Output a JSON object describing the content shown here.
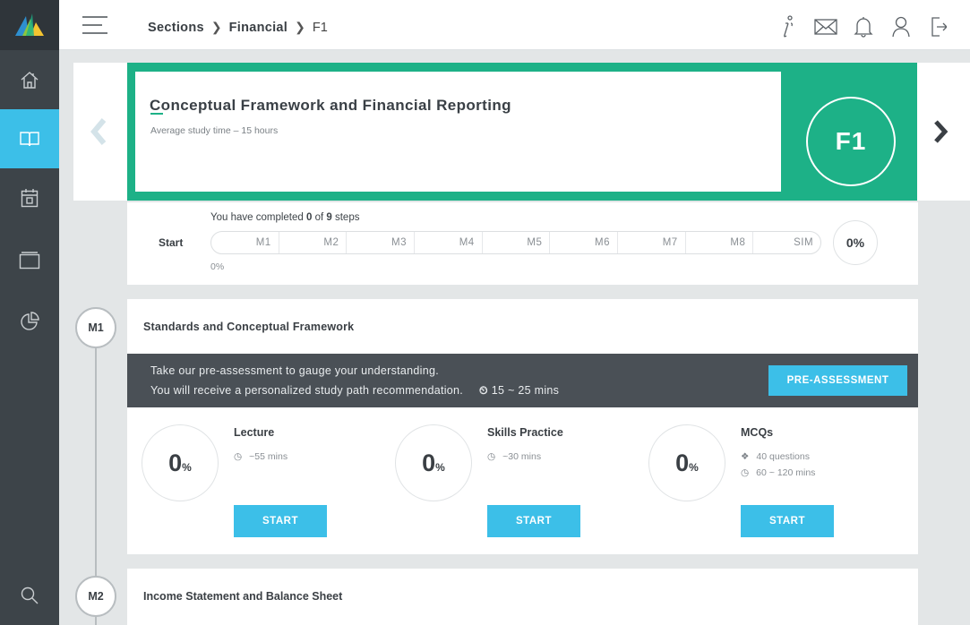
{
  "header": {
    "breadcrumb": [
      "Sections",
      "Financial",
      "F1"
    ]
  },
  "hero": {
    "title": "Conceptual Framework and Financial Reporting",
    "subtitle": "Average study time – 15 hours",
    "badge": "F1"
  },
  "progress": {
    "text_prefix": "You have completed ",
    "completed": "0",
    "text_middle": " of ",
    "total": "9",
    "text_suffix": " steps",
    "start_label": "Start",
    "steps": [
      "M1",
      "M2",
      "M3",
      "M4",
      "M5",
      "M6",
      "M7",
      "M8",
      "SIM"
    ],
    "percent": "0%",
    "below_percent": "0%"
  },
  "modules": [
    {
      "node": "M1",
      "title": "Standards and Conceptual Framework",
      "pre_assessment": {
        "line1": "Take our pre-assessment to gauge your understanding.",
        "line2": "You will receive a personalized study path recommendation.",
        "time": "15 ~ 25 mins",
        "button": "PRE-ASSESSMENT"
      },
      "activities": [
        {
          "title": "Lecture",
          "percent": "0",
          "meta1": "~55 mins",
          "meta2": "",
          "button": "START"
        },
        {
          "title": "Skills Practice",
          "percent": "0",
          "meta1": "~30 mins",
          "meta2": "",
          "button": "START"
        },
        {
          "title": "MCQs",
          "percent": "0",
          "meta1": "40 questions",
          "meta2": "60 ~ 120 mins",
          "button": "START"
        }
      ]
    },
    {
      "node": "M2",
      "title": "Income Statement and Balance Sheet"
    }
  ],
  "percent_symbol": "%",
  "colors": {
    "sidebar": "#3d4449",
    "accent_blue": "#3cbfe8",
    "accent_green": "#1db187",
    "dark_bar": "#4a5056"
  },
  "icons": {
    "sidebar": [
      "logo-icon",
      "home-icon",
      "book-icon",
      "calendar-icon",
      "window-icon",
      "pie-chart-icon",
      "search-icon"
    ],
    "top": [
      "info-icon",
      "mail-icon",
      "bell-icon",
      "user-icon",
      "logout-icon"
    ]
  }
}
